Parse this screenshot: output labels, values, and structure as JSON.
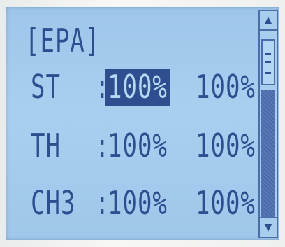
{
  "screen": {
    "title": "[EPA]",
    "rows": [
      {
        "label": "ST",
        "colon": ":",
        "value_left": "100%",
        "value_right": "100%",
        "selected": "left"
      },
      {
        "label": "TH",
        "colon": ":",
        "value_left": "100%",
        "value_right": "100%"
      },
      {
        "label": "CH3",
        "colon": ":",
        "value_left": "100%",
        "value_right": "100%"
      }
    ]
  },
  "scrollbar": {
    "up_icon": "arrow-up-icon",
    "down_icon": "arrow-down-icon",
    "up_glyph": "▲",
    "down_glyph": "▼",
    "position": 0.0
  },
  "colors": {
    "lcd_background": "#a9cff0",
    "lcd_text": "#2f4e8f"
  }
}
